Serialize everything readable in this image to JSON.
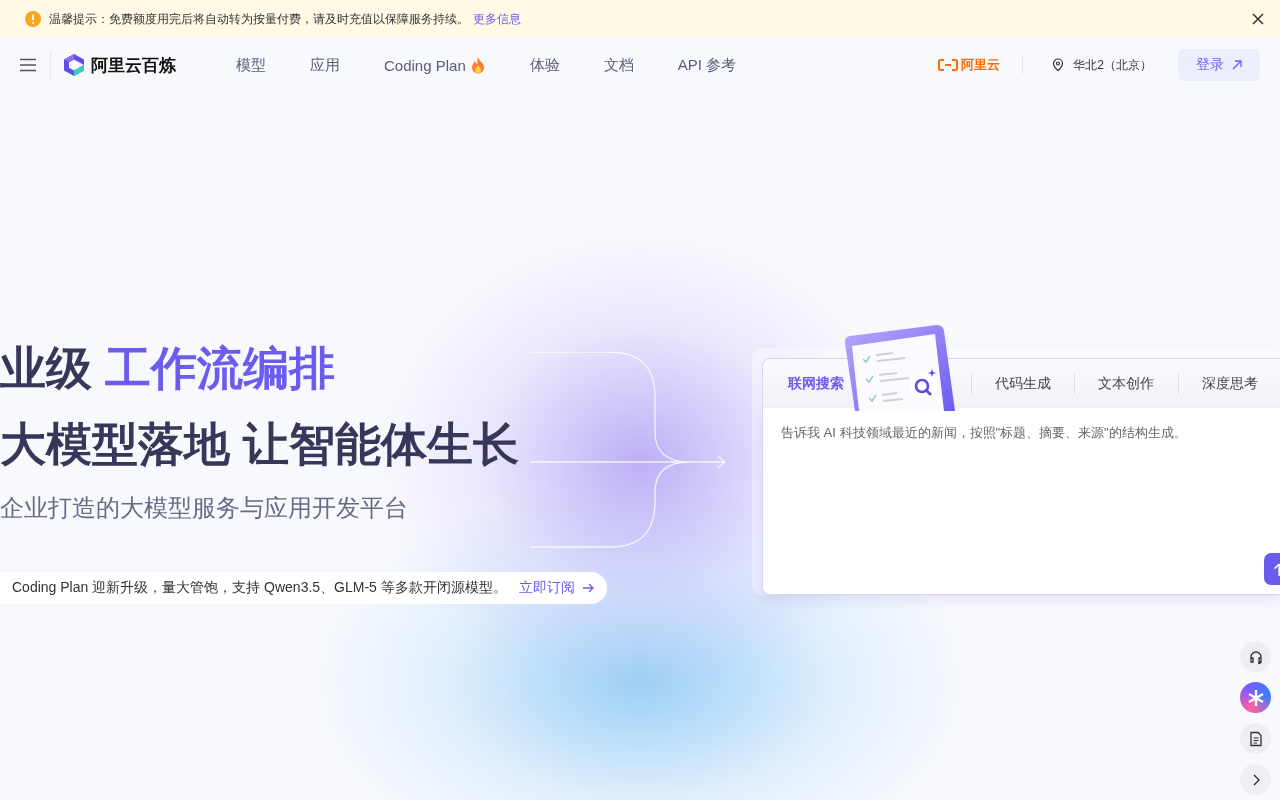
{
  "notice": {
    "text": "温馨提示：免费额度用完后将自动转为按量付费，请及时充值以保障服务持续。",
    "link": "更多信息"
  },
  "nav": {
    "brand": "阿里云百炼",
    "items": [
      {
        "label": "模型",
        "hot": false
      },
      {
        "label": "应用",
        "hot": false
      },
      {
        "label": "Coding Plan",
        "hot": true
      },
      {
        "label": "体验",
        "hot": false
      },
      {
        "label": "文档",
        "hot": false
      },
      {
        "label": "API 参考",
        "hot": false
      }
    ],
    "partner": "阿里云",
    "region": "华北2（北京）",
    "login": "登录"
  },
  "hero": {
    "line1_plain": "业级",
    "line1_highlight": "工作流编排",
    "line2": "大模型落地 让智能体生长",
    "subtitle": "企业打造的大模型服务与应用开发平台"
  },
  "promo": {
    "text": "Coding Plan 迎新升级，量大管饱，支持 Qwen3.5、GLM-5 等多款开闭源模型。",
    "link": "立即订阅"
  },
  "demo": {
    "tabs": [
      {
        "label": "联网搜索",
        "selected": true
      },
      {
        "label": "代码生成",
        "selected": false
      },
      {
        "label": "文本创作",
        "selected": false
      },
      {
        "label": "深度思考",
        "selected": false
      }
    ],
    "placeholder": "告诉我 AI 科技领域最近的新闻，按照\"标题、摘要、来源\"的结构生成。"
  },
  "side_tools": [
    {
      "kind": "support"
    },
    {
      "kind": "assistant"
    },
    {
      "kind": "document"
    },
    {
      "kind": "expand"
    }
  ]
}
